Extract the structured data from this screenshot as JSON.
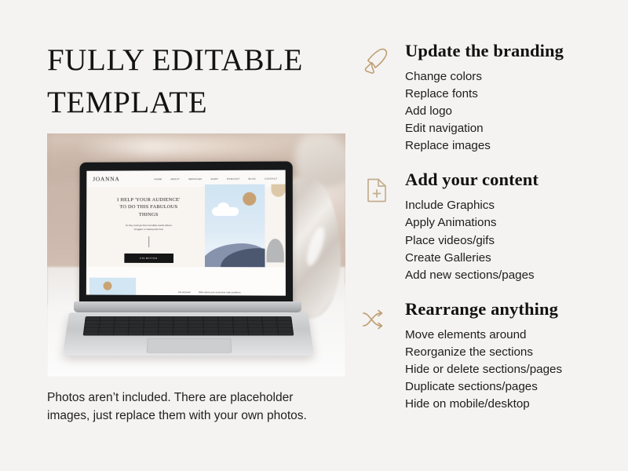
{
  "slide": {
    "background_color": "#f4f3f1",
    "accent_color": "#bfa074",
    "text_color": "#1d1d1d"
  },
  "left": {
    "title": "FULLY EDITABLE\nTEMPLATE",
    "caption": "Photos aren’t included. There are placeholder\nimages, just replace them with your own photos."
  },
  "mockup": {
    "site_logo": "JOANNA",
    "nav_items": [
      "HOME",
      "ABOUT",
      "SERVICES",
      "SHOP",
      "PODCAST",
      "BLOG",
      "CONTACT"
    ],
    "hero_heading": "I HELP 'YOUR AUDIENCE'\nTO DO THIS FABULOUS\nTHINGS",
    "hero_subtext": "So they could get their incredible results without\n'struggles' or wasting their time",
    "cta_label": "CTA BUTTON",
    "band_text_left": "Are purpose!",
    "band_text_right": "Write about your customers main problems."
  },
  "sections": [
    {
      "icon": "paintbrush-icon",
      "heading": "Update the branding",
      "items": [
        "Change colors",
        "Replace fonts",
        "Add logo",
        "Edit navigation",
        "Replace images"
      ]
    },
    {
      "icon": "file-plus-icon",
      "heading": "Add your content",
      "items": [
        "Include Graphics",
        "Apply Animations",
        "Place videos/gifs",
        "Create Galleries",
        "Add new sections/pages"
      ]
    },
    {
      "icon": "shuffle-icon",
      "heading": "Rearrange anything",
      "items": [
        "Move elements around",
        "Reorganize the sections",
        "Hide or delete sections/pages",
        "Duplicate sections/pages",
        "Hide on mobile/desktop"
      ]
    }
  ]
}
